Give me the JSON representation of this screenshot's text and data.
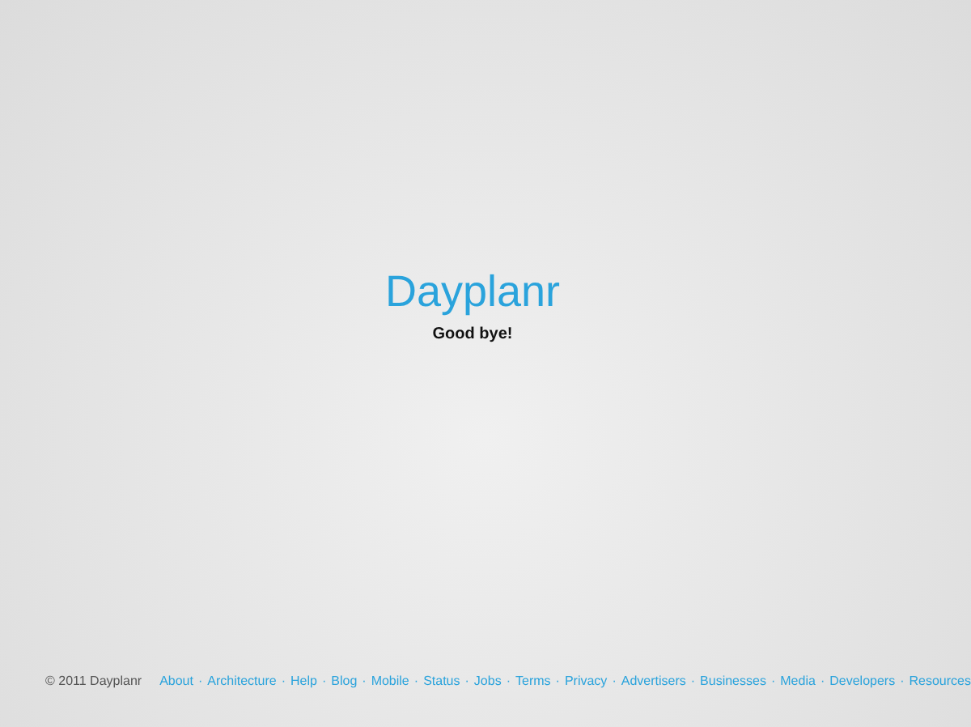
{
  "brand": {
    "title": "Dayplanr",
    "message": "Good bye!"
  },
  "footer": {
    "copyright": "© 2011 Dayplanr",
    "separator": "·",
    "links": [
      "About",
      "Architecture",
      "Help",
      "Blog",
      "Mobile",
      "Status",
      "Jobs",
      "Terms",
      "Privacy",
      "Advertisers",
      "Businesses",
      "Media",
      "Developers",
      "Resources"
    ]
  }
}
